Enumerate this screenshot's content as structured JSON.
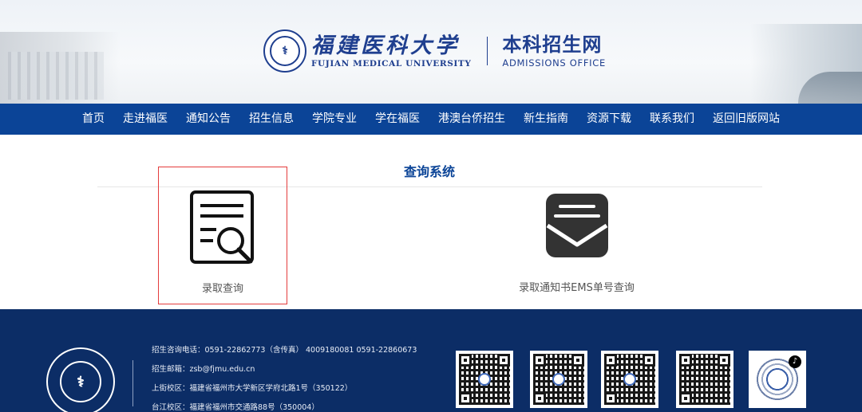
{
  "header": {
    "university_cn": "福建医科大学",
    "university_en": "FUJIAN MEDICAL UNIVERSITY",
    "office_cn": "本科招生网",
    "office_en": "ADMISSIONS OFFICE"
  },
  "nav": {
    "items": [
      "首页",
      "走进福医",
      "通知公告",
      "招生信息",
      "学院专业",
      "学在福医",
      "港澳台侨招生",
      "新生指南",
      "资源下载",
      "联系我们",
      "返回旧版网站"
    ]
  },
  "main": {
    "title": "查询系统",
    "cards": [
      {
        "label": "录取查询",
        "icon": "document-search-icon",
        "selected": true
      },
      {
        "label": "录取通知书EMS单号查询",
        "icon": "mail-envelope-icon",
        "selected": false
      }
    ]
  },
  "footer": {
    "lines": [
      "招生咨询电话：0591-22862773（含传真） 4009180081 0591-22860673",
      "招生邮箱：zsb@fjmu.edu.cn",
      "上街校区：福建省福州市大学新区学府北路1号（350122）",
      "台江校区：福建省福州市交通路88号（350004）"
    ],
    "qr_codes": [
      "qr-code-icon",
      "qr-code-icon",
      "qr-code-icon",
      "qr-code-icon",
      "tiktok-qr-code-icon"
    ]
  },
  "colors": {
    "brand_blue": "#0b4497",
    "footer_navy": "#0c2d66",
    "selection_red": "#e43c3c"
  }
}
